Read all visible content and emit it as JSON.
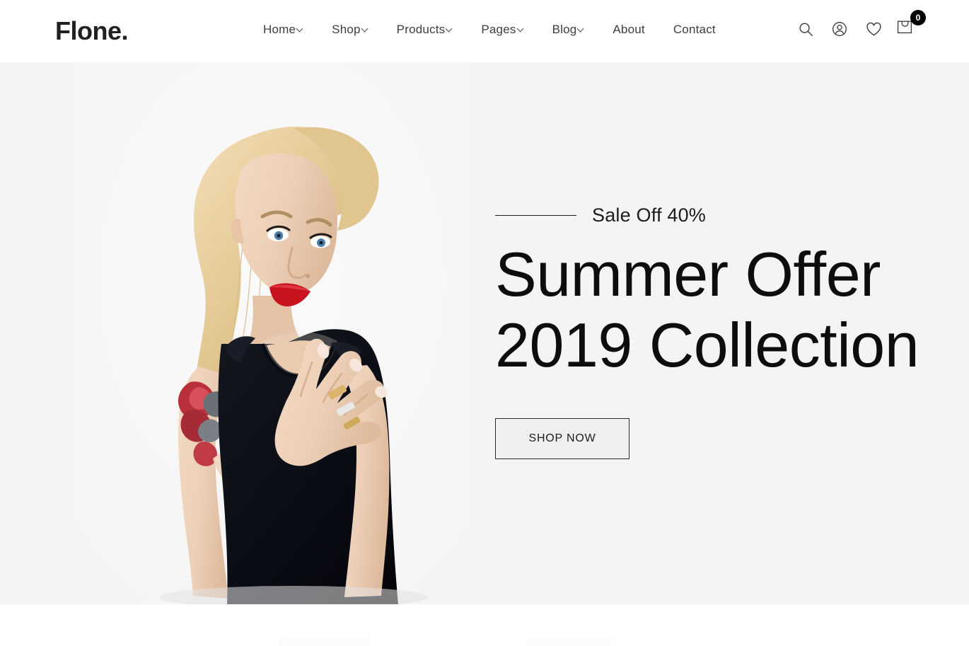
{
  "header": {
    "brand": "Flone.",
    "nav": [
      {
        "label": "Home",
        "has_dropdown": true
      },
      {
        "label": "Shop",
        "has_dropdown": true
      },
      {
        "label": "Products",
        "has_dropdown": true
      },
      {
        "label": "Pages",
        "has_dropdown": true
      },
      {
        "label": "Blog",
        "has_dropdown": true
      },
      {
        "label": "About",
        "has_dropdown": false
      },
      {
        "label": "Contact",
        "has_dropdown": false
      }
    ],
    "actions": {
      "search_icon": "search-icon",
      "account_icon": "user-account-icon",
      "wishlist_icon": "heart-icon",
      "cart_icon": "shopping-bag-icon",
      "cart_count": "0"
    }
  },
  "hero": {
    "eyebrow": "Sale Off 40%",
    "title_line1": "Summer Offer",
    "title_line2": "2019 Collection",
    "cta_label": "SHOP NOW",
    "background_color": "#f4f4f4",
    "image_alt": "blonde-female-model-black-dress"
  },
  "colors": {
    "page_background": "#ffffff",
    "hero_background": "#f4f4f4",
    "text_primary": "#0d0d0d",
    "text_nav": "#3e3e3e",
    "badge_background": "#000000",
    "badge_text": "#ffffff",
    "button_fill": "#efefef",
    "button_border": "#2b2b2b",
    "accent": "#a749ff"
  }
}
